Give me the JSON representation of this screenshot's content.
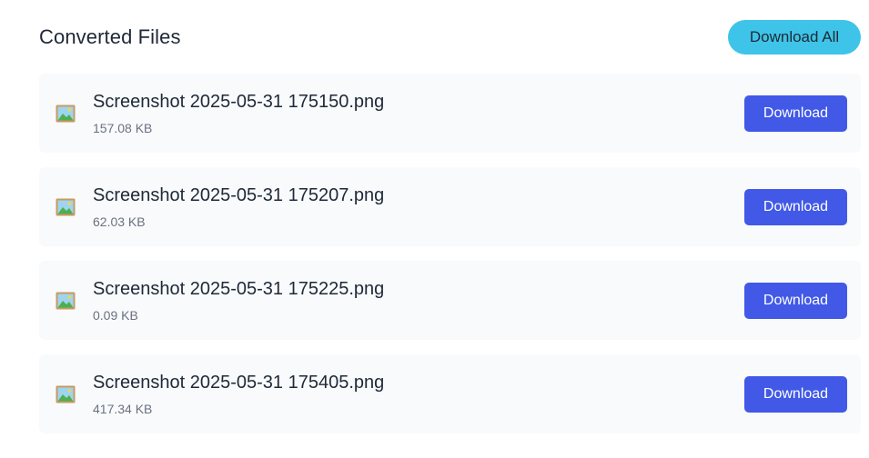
{
  "section": {
    "title": "Converted Files",
    "download_all_label": "Download All"
  },
  "files": [
    {
      "name": "Screenshot 2025-05-31 175150.png",
      "size": "157.08 KB",
      "icon": "image-file-icon",
      "button_label": "Download"
    },
    {
      "name": "Screenshot 2025-05-31 175207.png",
      "size": "62.03 KB",
      "icon": "image-file-icon",
      "button_label": "Download"
    },
    {
      "name": "Screenshot 2025-05-31 175225.png",
      "size": "0.09 KB",
      "icon": "image-file-icon",
      "button_label": "Download"
    },
    {
      "name": "Screenshot 2025-05-31 175405.png",
      "size": "417.34 KB",
      "icon": "image-file-icon",
      "button_label": "Download"
    }
  ],
  "colors": {
    "download_all_bg": "#3ec4e8",
    "download_btn_bg": "#4159e6",
    "row_bg": "#f8fafc"
  }
}
